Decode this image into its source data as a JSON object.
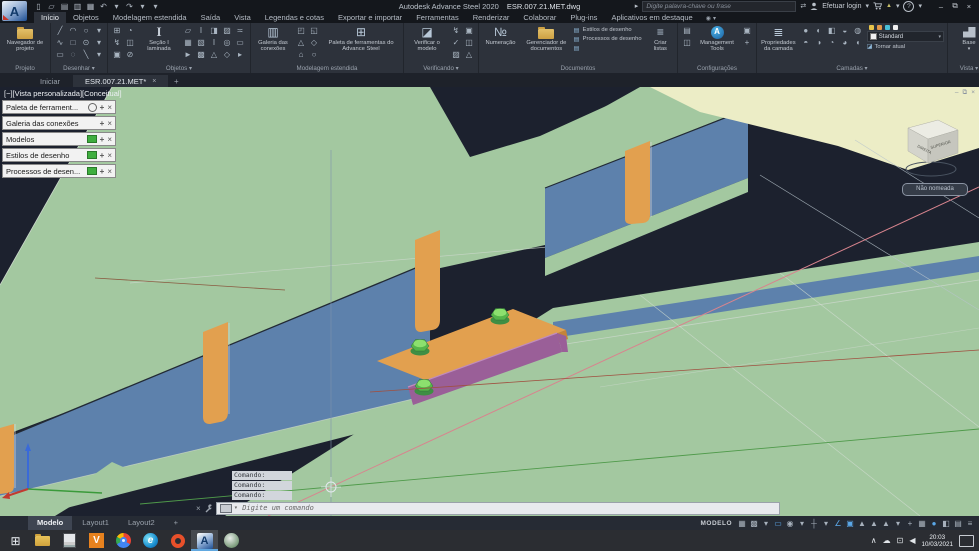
{
  "ui": {
    "caret": "▾"
  },
  "colors": {
    "bg": "#1c212e",
    "green": "#a3c8a0",
    "blue_web": "#5d81ac",
    "orange": "#e2a04f",
    "orange_dark": "#c58438",
    "purple": "#9a5f98",
    "purple_light": "#c08cbc",
    "bolt": "#8ce06e",
    "bolt_mid": "#56b54a",
    "bolt_dark": "#3e8e44",
    "yellow": "#ecedc6",
    "pink": "#d8848e",
    "red_line": "#a05040",
    "green_line": "#4f9a4a",
    "white_line": "#ccd8cc",
    "ucs_x": "#c23a30",
    "ucs_y": "#3a9a3a",
    "ucs_z": "#3a6ad8"
  },
  "title_bar": {
    "logo_letter": "A",
    "app_title": "Autodesk Advance Steel 2020",
    "doc_title": "ESR.007.21.MET.dwg",
    "pre_search_icon": "▸",
    "search_placeholder": "Digite palavra-chave ou frase",
    "exchange_icon": "⇄",
    "login_label": "Efetuar login",
    "alert_icon": "▲",
    "help_icon": "?",
    "window_controls": [
      {
        "name": "minimize-button",
        "g": "–"
      },
      {
        "name": "restore-button",
        "g": "⧉"
      },
      {
        "name": "close-button",
        "g": "×"
      }
    ]
  },
  "quick_access": [
    {
      "name": "new-file-button",
      "g": "▯"
    },
    {
      "name": "open-button",
      "g": "▱"
    },
    {
      "name": "save-button",
      "g": "▤"
    },
    {
      "name": "plot-button",
      "g": "▥"
    },
    {
      "name": "print-button",
      "g": "▦"
    },
    {
      "name": "undo-button",
      "g": "↶"
    },
    {
      "name": "undo-caret",
      "g": "▾"
    },
    {
      "name": "redo-button",
      "g": "↷"
    },
    {
      "name": "redo-caret",
      "g": "▾"
    },
    {
      "name": "qat-customize-button",
      "g": "▾"
    }
  ],
  "ribbon": {
    "tabs": [
      {
        "label": "Início",
        "active": true
      },
      {
        "label": "Objetos"
      },
      {
        "label": "Modelagem estendida"
      },
      {
        "label": "Saída"
      },
      {
        "label": "Vista"
      },
      {
        "label": "Legendas e cotas"
      },
      {
        "label": "Exportar e importar"
      },
      {
        "label": "Ferramentas"
      },
      {
        "label": "Renderizar"
      },
      {
        "label": "Colaborar"
      },
      {
        "label": "Plug-ins"
      },
      {
        "label": "Aplicativos em destaque"
      }
    ],
    "tab_end_icon": "◉",
    "panels": {
      "projeto": {
        "label": "Projeto",
        "big": "Navegador de projeto"
      },
      "desenhar": {
        "label": "Desenhar ▾",
        "icons": [
          "╱",
          "◠",
          "○",
          "▾",
          "∿",
          "□",
          "⊙",
          "▾",
          "▭",
          "◌",
          "╲",
          "▾"
        ]
      },
      "objetos": {
        "label": "Objetos ▾",
        "big": "Seção I laminada",
        "big_icon": "I",
        "icons_a": [
          "⊞",
          "◔",
          "↯",
          "◫",
          "▣",
          "⊘"
        ],
        "icons_b": [
          "▱",
          "I",
          "◨",
          "▨",
          "≍",
          "▦",
          "▧",
          "I",
          "◎",
          "▭",
          "►",
          "▩",
          "△",
          "◇",
          "▸"
        ]
      },
      "modelagem": {
        "label": "Modelagem estendida",
        "big1": "Galeria das conexões",
        "big1_icon": "▥",
        "big2": "Paleta de ferramentas do Advance Steel",
        "big2_icon": "⊞",
        "icons": [
          "◰",
          "◱",
          "△",
          "◇",
          "⌂",
          "○"
        ]
      },
      "verificando": {
        "label": "Verificando ▾",
        "big": "Verificar o modelo",
        "big_icon": "◪",
        "icons": [
          "↯",
          "▣",
          "✓",
          "◫",
          "▨",
          "△"
        ]
      },
      "documentos": {
        "label": "Documentos",
        "big1": "Numeração",
        "big1_icon": "№",
        "big2": "Gerenciador de documentos",
        "rows": [
          "Estilos de desenho",
          "Processos de desenho"
        ],
        "row_icon": "▤",
        "big3": "Criar listas",
        "big3_icon": "≡"
      },
      "config": {
        "label": "Configurações",
        "big": "Management Tools",
        "big_icon": "A",
        "icons_l": [
          "▤",
          "◫"
        ],
        "icons_r": [
          "▣",
          "+"
        ]
      },
      "camadas": {
        "label": "Camadas ▾",
        "big": "Propriedades da camada",
        "big_icon": "≣",
        "dots": [
          "#e8c44a",
          "#e2984a",
          "#48c0d8",
          "#f0f0f0"
        ],
        "dropdown_value": "Standard",
        "action": "Tornar atual",
        "action_icon": "◪",
        "icons": [
          "●",
          "◐",
          "◧",
          "◒",
          "◍",
          "◓",
          "◑",
          "◔",
          "◕",
          "◖"
        ]
      },
      "vista": {
        "label": "Vista ▾",
        "big": "Base"
      }
    }
  },
  "file_tabs": {
    "start_tab": "Iniciar",
    "doc_tab": "ESR.007.21.MET*",
    "close_icon": "×",
    "new_tab_icon": "+"
  },
  "viewport": {
    "controls": "[−][Vista personalizada][Conceitual]",
    "window_icons": [
      {
        "name": "viewport-minimize-icon",
        "g": "–"
      },
      {
        "name": "viewport-restore-icon",
        "g": "⧉"
      },
      {
        "name": "viewport-close-icon",
        "g": "×"
      }
    ],
    "palettes": [
      {
        "label": "Paleta de ferrament...",
        "cls": "has-gear",
        "name": "palette-tools"
      },
      {
        "label": "Galeria das conexões",
        "cls": "",
        "name": "palette-connection-gallery"
      },
      {
        "label": "Modelos",
        "cls": "has-img",
        "name": "palette-models"
      },
      {
        "label": "Estilos de desenho",
        "cls": "has-img",
        "name": "palette-drawing-styles"
      },
      {
        "label": "Processos de desen...",
        "cls": "has-img",
        "name": "palette-drawing-processes"
      }
    ],
    "palette_move_icon": "+",
    "palette_close_icon": "×",
    "viewcube": {
      "left_label": "DIREITA",
      "right_label": "SUPERIOR",
      "tooltip": "Não nomeada"
    },
    "command_history": [
      "Comando:",
      "Comando:",
      "Comando:"
    ],
    "command_close_icon": "×",
    "command_placeholder": "Digite um comando",
    "command_caret": "▾"
  },
  "status_bar": {
    "layout_tabs": [
      {
        "label": "Modelo",
        "active": true
      },
      {
        "label": "Layout1"
      },
      {
        "label": "Layout2"
      }
    ],
    "new_layout_icon": "+",
    "mode_label": "MODELO",
    "icons": [
      {
        "g": "▦"
      },
      {
        "g": "▩"
      },
      {
        "g": "▾"
      },
      {
        "g": "▭",
        "on": true
      },
      {
        "g": "◉"
      },
      {
        "g": "▾"
      },
      {
        "g": "┼"
      },
      {
        "g": "▾"
      },
      {
        "g": "∠",
        "on": true
      },
      {
        "g": "▣",
        "on": true
      },
      {
        "g": "▲"
      },
      {
        "g": "▲"
      },
      {
        "g": "▲"
      },
      {
        "g": "▾"
      },
      {
        "g": "+"
      },
      {
        "g": "▦"
      },
      {
        "g": "●",
        "on": true
      },
      {
        "g": "◧"
      },
      {
        "g": "▤"
      },
      {
        "g": "≡"
      }
    ]
  },
  "taskbar": {
    "apps": [
      {
        "name": "start-button",
        "g": "⊞",
        "cls": "start"
      },
      {
        "name": "file-explorer",
        "cls": "folder"
      },
      {
        "name": "text-editor-app",
        "cls": "docapp"
      },
      {
        "name": "v-app",
        "g": "V",
        "cls": "vapp"
      },
      {
        "name": "chrome-app",
        "cls": "chrome"
      },
      {
        "name": "edge-app",
        "g": "e",
        "cls": "edge"
      },
      {
        "name": "ring-app",
        "cls": "ring"
      },
      {
        "name": "advance-steel-app",
        "g": "A",
        "cls": "asteel",
        "active": true
      },
      {
        "name": "viewer-app",
        "cls": "misc"
      }
    ],
    "tray_icons": [
      {
        "name": "tray-expand-icon",
        "g": "∧"
      },
      {
        "name": "onedrive-icon",
        "g": "☁"
      },
      {
        "name": "network-icon",
        "g": "⊡"
      },
      {
        "name": "volume-icon",
        "g": "◀"
      }
    ],
    "clock_time": "20:03",
    "clock_date": "10/03/2021"
  }
}
